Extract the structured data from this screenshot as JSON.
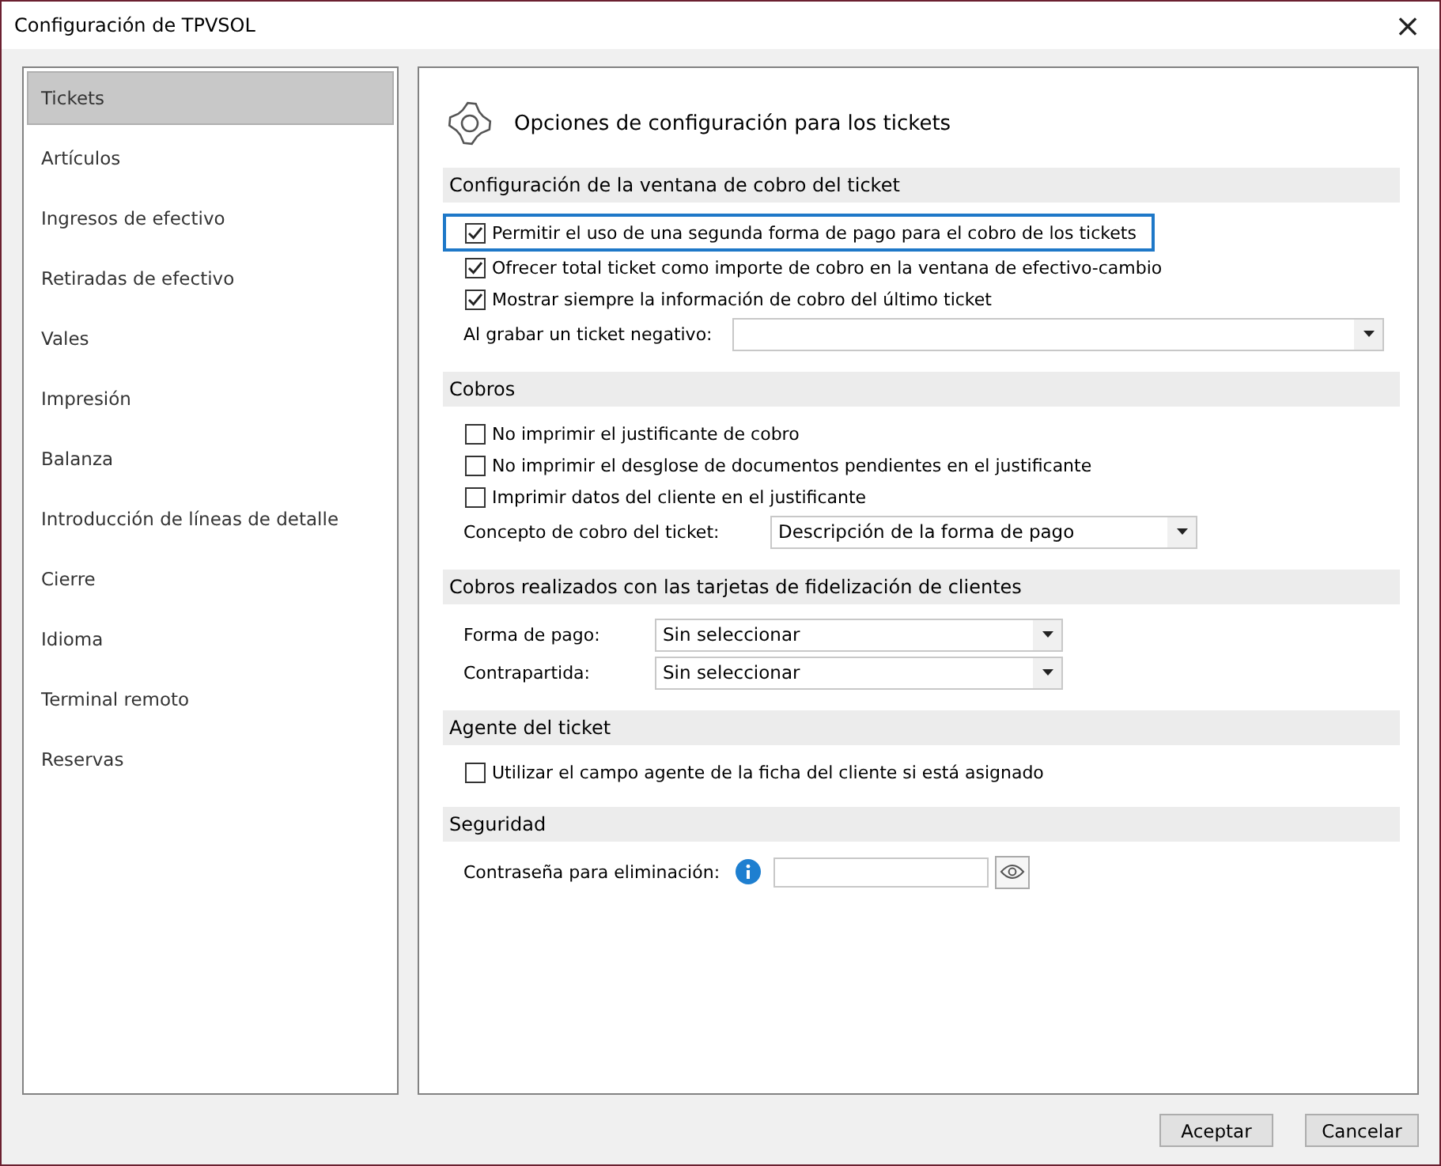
{
  "window": {
    "title": "Configuración de TPVSOL",
    "close": "×"
  },
  "sidebar": {
    "items": [
      {
        "label": "Tickets",
        "selected": true
      },
      {
        "label": "Artículos",
        "selected": false
      },
      {
        "label": "Ingresos de efectivo",
        "selected": false
      },
      {
        "label": "Retiradas de efectivo",
        "selected": false
      },
      {
        "label": "Vales",
        "selected": false
      },
      {
        "label": "Impresión",
        "selected": false
      },
      {
        "label": "Balanza",
        "selected": false
      },
      {
        "label": "Introducción de líneas de detalle",
        "selected": false
      },
      {
        "label": "Cierre",
        "selected": false
      },
      {
        "label": "Idioma",
        "selected": false
      },
      {
        "label": "Terminal remoto",
        "selected": false
      },
      {
        "label": "Reservas",
        "selected": false
      }
    ]
  },
  "panel": {
    "title": "Opciones de configuración para los tickets",
    "sections": [
      {
        "title": "Configuración de la ventana de cobro del ticket",
        "items": [
          {
            "kind": "checkbox",
            "label": "Permitir el uso de una segunda forma de pago para el cobro de los tickets",
            "checked": true,
            "focused": true
          },
          {
            "kind": "checkbox",
            "label": "Ofrecer total ticket como importe de cobro en la ventana de efectivo-cambio",
            "checked": true,
            "focused": false
          },
          {
            "kind": "checkbox",
            "label": "Mostrar siempre la información de cobro del último ticket",
            "checked": true,
            "focused": false
          },
          {
            "kind": "select",
            "label": "Al grabar un ticket negativo:"
          }
        ]
      },
      {
        "title": "Cobros",
        "items": [
          {
            "kind": "checkbox",
            "label": "No imprimir el justificante de cobro",
            "checked": false,
            "focused": false
          },
          {
            "kind": "checkbox",
            "label": "No imprimir el desglose de documentos pendientes en el justificante",
            "checked": false,
            "focused": false
          },
          {
            "kind": "checkbox",
            "label": "Imprimir datos del cliente en el justificante",
            "checked": false,
            "focused": false
          },
          {
            "kind": "select",
            "label": "Concepto de cobro del ticket:",
            "value": "Descripción de la forma de pago"
          }
        ]
      },
      {
        "title": "Cobros realizados con las tarjetas de fidelización de clientes",
        "items": [
          {
            "kind": "select",
            "label": "Forma de pago:",
            "value": "Sin seleccionar"
          },
          {
            "kind": "select",
            "label": "Contrapartida:",
            "value": "Sin seleccionar"
          }
        ]
      },
      {
        "title": "Agente del ticket",
        "items": [
          {
            "kind": "checkbox",
            "label": "Utilizar el campo agente de la ficha del cliente si está asignado",
            "checked": false,
            "focused": false
          }
        ]
      },
      {
        "title": "Seguridad",
        "items": [
          {
            "kind": "password",
            "label": "Contraseña para eliminación:"
          }
        ]
      }
    ]
  },
  "buttons": [
    "Aceptar",
    "Cancelar"
  ]
}
